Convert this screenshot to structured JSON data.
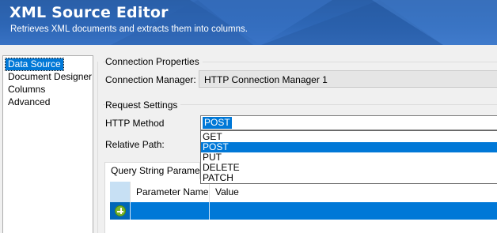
{
  "header": {
    "title": "XML Source Editor",
    "subtitle": "Retrieves XML documents and extracts them into columns."
  },
  "sidebar": {
    "items": [
      {
        "label": "Data Source",
        "selected": true
      },
      {
        "label": "Document Designer",
        "selected": false
      },
      {
        "label": "Columns",
        "selected": false
      },
      {
        "label": "Advanced",
        "selected": false
      }
    ]
  },
  "connection": {
    "group_label": "Connection Properties",
    "manager_label": "Connection Manager:",
    "manager_value": "HTTP Connection Manager 1"
  },
  "request": {
    "group_label": "Request Settings",
    "method_label": "HTTP Method",
    "method_value": "POST",
    "path_label": "Relative Path:",
    "method_options": [
      "GET",
      "POST",
      "PUT",
      "DELETE",
      "PATCH"
    ]
  },
  "query": {
    "tab_label": "Query String Parameters",
    "columns": [
      "Parameter Name",
      "Value"
    ],
    "new_row_icon": "add-row-icon"
  },
  "colors": {
    "header_blue": "#2d66b5",
    "selection_blue": "#0078d7",
    "add_icon_green": "#7ab52b"
  }
}
